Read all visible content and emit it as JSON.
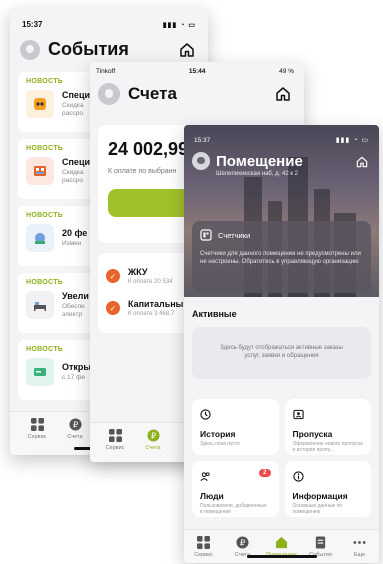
{
  "events_screen": {
    "status_time": "15:37",
    "title": "События",
    "cards": [
      {
        "tag": "НОВОСТЬ",
        "title": "Специ",
        "subtitle": "Скидка\nрассро",
        "icon": "tablet-icon",
        "color": "#f0a020"
      },
      {
        "tag": "НОВОСТЬ",
        "title": "Специ",
        "subtitle": "Скидка\nрассро",
        "icon": "cabinet-icon",
        "color": "#e8622b"
      },
      {
        "tag": "НОВОСТЬ",
        "title": "20 фе",
        "subtitle": "Измен",
        "icon": "dial-icon",
        "color": "#6fa0e0"
      },
      {
        "tag": "НОВОСТЬ",
        "title": "Увели",
        "subtitle": "Обеспе\nэлектр",
        "icon": "bed-icon",
        "color": "#888888"
      },
      {
        "tag": "НОВОСТЬ",
        "title": "Откры",
        "subtitle": "с 17 фе",
        "icon": "card-icon",
        "color": "#3ab07a"
      }
    ],
    "tabs": [
      {
        "label": "Сервис",
        "icon": "grid-icon"
      },
      {
        "label": "Счета",
        "icon": "ruble-icon"
      }
    ]
  },
  "bills_screen": {
    "status_carrier": "Tinkoff",
    "status_time": "15:44",
    "status_battery": "49 %",
    "title": "Счета",
    "balance": "24 002,99 ₽",
    "balance_note": "К оплате по выбранн",
    "pay_label": "С",
    "services": [
      {
        "title": "ЖКУ",
        "subtitle": "К оплате 20 534"
      },
      {
        "title": "Капитальны",
        "subtitle": "К оплате 3 468,7"
      }
    ],
    "tabs": [
      {
        "label": "Сервис",
        "icon": "grid-icon"
      },
      {
        "label": "Счета",
        "icon": "ruble-icon"
      }
    ]
  },
  "premises_screen": {
    "status_time": "15:37",
    "title": "Помещение",
    "address": "Шелепихинская наб, д. 42 к 2",
    "meters_title": "Счетчики",
    "meters_text": "Счетчики для данного помещения не предусмотрены или не настроены. Обратитесь в управляющую организацию",
    "active_title": "Активные",
    "active_empty": "Здесь будут отображаться активные заказы услуг, заявки и обращения",
    "tiles": [
      {
        "title": "История",
        "subtitle": "Здесь пока пусто",
        "icon": "clock-icon"
      },
      {
        "title": "Пропуска",
        "subtitle": "Оформление нового пропуска и история пропу...",
        "icon": "pass-icon"
      },
      {
        "title": "Люди",
        "subtitle": "Пользователи, добавленные в помещение",
        "icon": "people-icon",
        "badge": "2"
      },
      {
        "title": "Информация",
        "subtitle": "Основные данные по помещению",
        "icon": "info-icon"
      }
    ],
    "tabs": [
      {
        "label": "Сервис",
        "icon": "grid-icon"
      },
      {
        "label": "Счета",
        "icon": "ruble-icon"
      },
      {
        "label": "Помещение",
        "icon": "house-icon"
      },
      {
        "label": "События",
        "icon": "doc-icon"
      },
      {
        "label": "Еще",
        "icon": "dots-icon"
      }
    ]
  }
}
